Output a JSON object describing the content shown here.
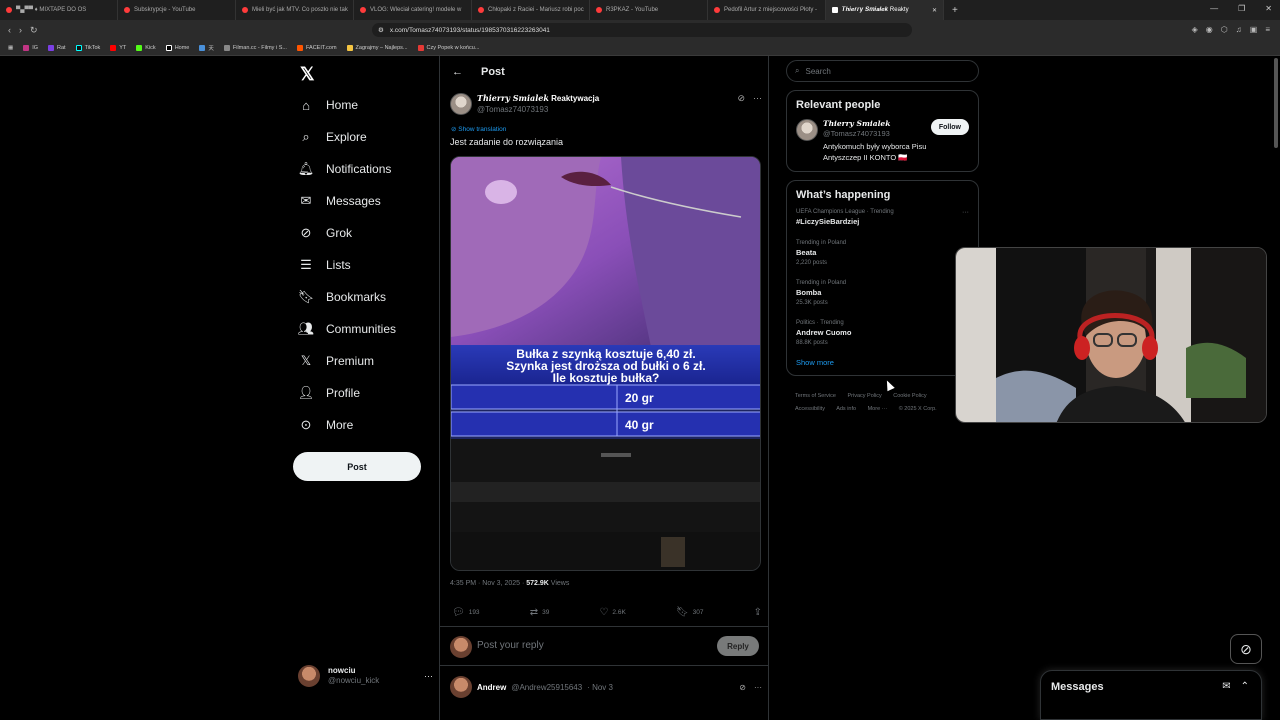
{
  "browser": {
    "tabs": [
      {
        "label": "▀▄▀▀ ♦ MIXTAPE DO OS"
      },
      {
        "label": "Subskrypcje - YouTube"
      },
      {
        "label": "Mieli być jak MTV. Co poszło nie tak"
      },
      {
        "label": "VLOG: Wleciał catering! modele w"
      },
      {
        "label": "Chłopaki z Raciei - Mariusz robi poc"
      },
      {
        "label": "R3PKAZ - YouTube"
      },
      {
        "label": "Pedofil Artur z miejscowości Płoty -"
      },
      {
        "label": "𝑻𝒉𝒊𝒆𝒓𝒓𝒚 𝑺𝒎𝒊𝒂𝒍𝒆𝒌 Reakty",
        "active": true
      }
    ],
    "url": "x.com/Tomasz74073193/status/1985370316223263041",
    "bookmarks": [
      "IG",
      "Rat",
      "TikTok",
      "YT",
      "Kick",
      "Home",
      "天",
      "Filman.cc - Filmy i S...",
      "FACEIT.com",
      "Zagrajmy – Najleps...",
      "Czy Popek w końcu..."
    ]
  },
  "sidebar": {
    "items": [
      {
        "label": "Home",
        "icon": "home-icon"
      },
      {
        "label": "Explore",
        "icon": "search-icon"
      },
      {
        "label": "Notifications",
        "icon": "bell-icon"
      },
      {
        "label": "Messages",
        "icon": "mail-icon"
      },
      {
        "label": "Grok",
        "icon": "grok-icon"
      },
      {
        "label": "Lists",
        "icon": "list-icon"
      },
      {
        "label": "Bookmarks",
        "icon": "bookmark-icon"
      },
      {
        "label": "Communities",
        "icon": "people-icon"
      },
      {
        "label": "Premium",
        "icon": "x-icon"
      },
      {
        "label": "Profile",
        "icon": "person-icon"
      },
      {
        "label": "More",
        "icon": "more-circle-icon"
      }
    ],
    "post_button": "Post",
    "account": {
      "name": "nowciu",
      "handle": "@nowciu_kick"
    }
  },
  "post": {
    "header_title": "Post",
    "author_name_fancy": "𝑻𝒉𝒊𝒆𝒓𝒓𝒚 𝑺𝒎𝒊𝒂𝒍𝒆𝒌",
    "author_name_rest": "Reaktywacja",
    "author_handle": "@Tomasz74073193",
    "show_translation": "Show translation",
    "text": "Jest zadanie do rozwiązania",
    "media": {
      "question_line1": "Bułka z szynką kosztuje 6,40 zł.",
      "question_line2": "Szynka jest droższa od bułki o 6 zł.",
      "question_line3": "Ile kosztuje bułka?",
      "answer_a": "20 gr",
      "answer_b": "40 gr"
    },
    "timestamp": "4:35 PM · Nov 3, 2025 · ",
    "views_count": "572.9K",
    "views_label": " Views",
    "stats": {
      "replies": "193",
      "reposts": "39",
      "likes": "2.6K",
      "bookmarks": "307"
    },
    "reply_placeholder": "Post your reply",
    "reply_button": "Reply",
    "next_reply": {
      "name": "Andrew",
      "handle": "@Andrew25915643",
      "date": "· Nov 3"
    }
  },
  "right": {
    "search_placeholder": "Search",
    "relevant_title": "Relevant people",
    "person": {
      "name": "𝑻𝒉𝒊𝒆𝒓𝒓𝒚 𝑺𝒎𝒊𝒂𝒍𝒆𝒌",
      "handle": "@Tomasz74073193",
      "follow": "Follow",
      "bio_line1": "Antykomuch były wyborca Pisu",
      "bio_line2": "Antyszczep II KONTO 🇵🇱"
    },
    "happening_title": "What’s happening",
    "trends": [
      {
        "context": "UEFA Champions League · Trending",
        "name": "#LiczySieBardziej",
        "count": ""
      },
      {
        "context": "Trending in Poland",
        "name": "Beata",
        "count": "2,220 posts"
      },
      {
        "context": "Trending in Poland",
        "name": "Bomba",
        "count": "25.3K posts"
      },
      {
        "context": "Politics · Trending",
        "name": "Andrew Cuomo",
        "count": "88.8K posts"
      }
    ],
    "show_more": "Show more",
    "footer": [
      "Terms of Service",
      "Privacy Policy",
      "Cookie Policy",
      "Accessibility",
      "Ads info",
      "More ···",
      "© 2025 X Corp."
    ]
  },
  "messages_drawer": {
    "title": "Messages"
  },
  "colors": {
    "accent": "#1d9bf0",
    "background": "#000000",
    "border": "#2f3336"
  }
}
